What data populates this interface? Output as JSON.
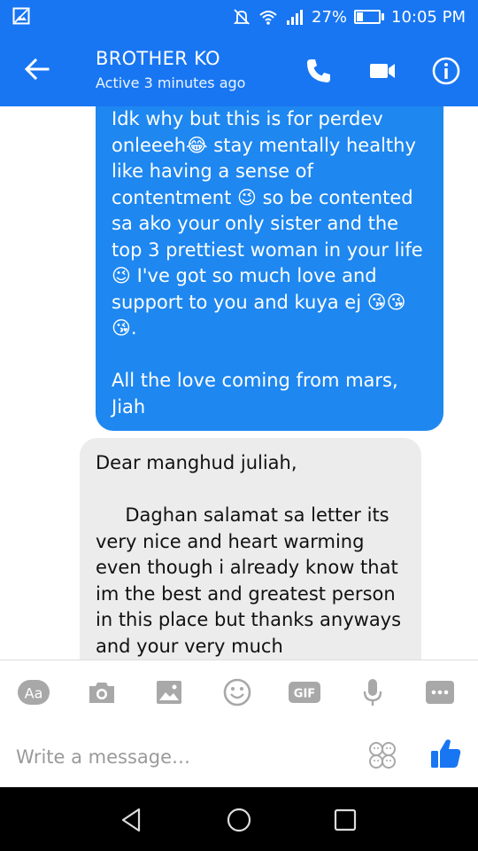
{
  "status_bar": {
    "battery": "27%",
    "battery_level": 0.27,
    "time": "10:05 PM"
  },
  "header": {
    "contact_name": "BROTHER KO",
    "contact_status": "Active 3 minutes ago"
  },
  "messages": [
    {
      "direction": "outgoing",
      "text": "Idk why but this is for perdev onleeeh😂 stay mentally healthy like having a sense of contentment 😉 so be contented sa ako your only sister and the top 3 prettiest woman in your life 😉 I've got so much love and support to you and kuya ej 😘😘😘.\n\nAll the love coming from mars,\nJiah"
    },
    {
      "direction": "incoming",
      "text": "Dear manghud juliah,\n\n     Daghan salamat sa letter its very nice and heart warming even though i already know that im the best and greatest person in this place but thanks anyways and your very much"
    }
  ],
  "action_bar": {
    "aa_label": "Aa",
    "gif_label": "GIF"
  },
  "composer": {
    "placeholder": "Write a message…",
    "value": ""
  },
  "colors": {
    "brand_blue": "#1876f2",
    "outgoing_bubble": "#1e87f0",
    "incoming_bubble": "#ececec",
    "icon_gray": "#a8a8a8"
  }
}
